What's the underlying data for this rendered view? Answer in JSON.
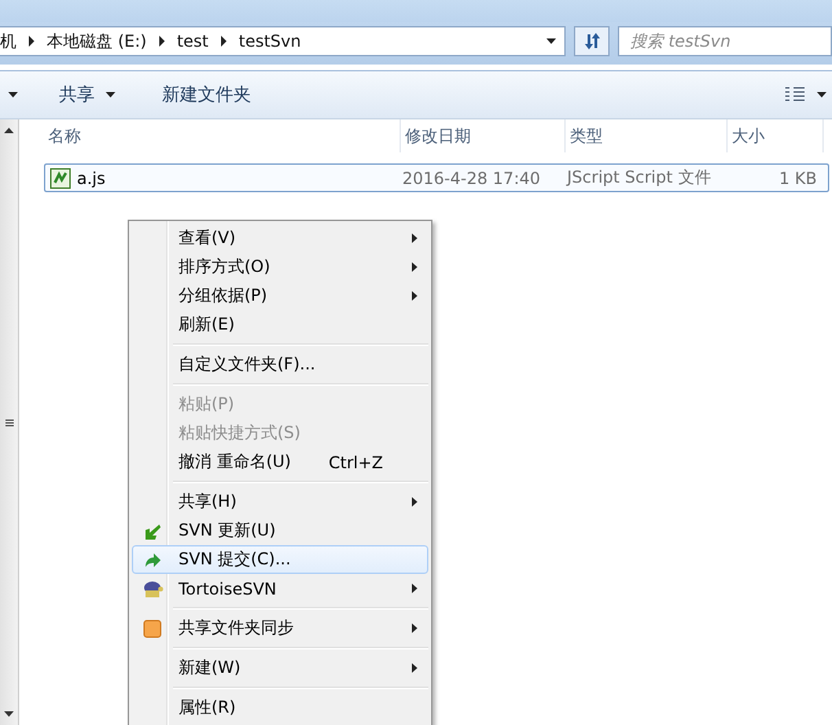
{
  "address_bar": {
    "crumbs": [
      "机",
      "本地磁盘 (E:)",
      "test",
      "testSvn"
    ]
  },
  "search": {
    "placeholder": "搜索 testSvn"
  },
  "toolbar": {
    "items": [
      {
        "label": "共享",
        "dropdown": true
      },
      {
        "label": "新建文件夹",
        "dropdown": false
      }
    ]
  },
  "table": {
    "columns": [
      "名称",
      "修改日期",
      "类型",
      "大小"
    ],
    "rows": [
      {
        "name": "a.js",
        "modified": "2016-4-28 17:40",
        "type": "JScript Script 文件",
        "size": "1 KB",
        "selected": true
      }
    ]
  },
  "context_menu": {
    "items": [
      {
        "kind": "item",
        "label": "查看(V)",
        "submenu": true,
        "disabled": false,
        "selected": false
      },
      {
        "kind": "item",
        "label": "排序方式(O)",
        "submenu": true,
        "disabled": false,
        "selected": false
      },
      {
        "kind": "item",
        "label": "分组依据(P)",
        "submenu": true,
        "disabled": false,
        "selected": false
      },
      {
        "kind": "item",
        "label": "刷新(E)",
        "submenu": false,
        "disabled": false,
        "selected": false
      },
      {
        "kind": "separator"
      },
      {
        "kind": "item",
        "label": "自定义文件夹(F)...",
        "submenu": false,
        "disabled": false,
        "selected": false
      },
      {
        "kind": "separator"
      },
      {
        "kind": "item",
        "label": "粘贴(P)",
        "submenu": false,
        "disabled": true,
        "selected": false
      },
      {
        "kind": "item",
        "label": "粘贴快捷方式(S)",
        "submenu": false,
        "disabled": true,
        "selected": false
      },
      {
        "kind": "item",
        "label": "撤消 重命名(U)",
        "shortcut": "Ctrl+Z",
        "submenu": false,
        "disabled": false,
        "selected": false
      },
      {
        "kind": "separator"
      },
      {
        "kind": "item",
        "label": "共享(H)",
        "submenu": true,
        "disabled": false,
        "selected": false
      },
      {
        "kind": "update",
        "label": "SVN 更新(U)",
        "submenu": false,
        "disabled": false,
        "selected": false
      },
      {
        "kind": "commit",
        "label": "SVN 提交(C)...",
        "submenu": false,
        "disabled": false,
        "selected": true
      },
      {
        "kind": "tortoise",
        "label": "TortoiseSVN",
        "submenu": true,
        "disabled": false,
        "selected": false
      },
      {
        "kind": "separator"
      },
      {
        "kind": "sync",
        "label": "共享文件夹同步",
        "submenu": true,
        "disabled": false,
        "selected": false
      },
      {
        "kind": "separator"
      },
      {
        "kind": "item",
        "label": "新建(W)",
        "submenu": true,
        "disabled": false,
        "selected": false
      },
      {
        "kind": "separator"
      },
      {
        "kind": "item",
        "label": "属性(R)",
        "submenu": false,
        "disabled": false,
        "selected": false
      }
    ]
  }
}
